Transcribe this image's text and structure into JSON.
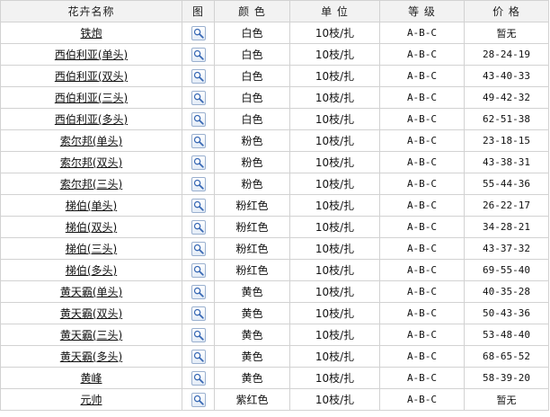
{
  "headers": [
    "花卉名称",
    "图",
    "颜 色",
    "单 位",
    "等 级",
    "价 格"
  ],
  "icon": "magnifier-icon",
  "rows": [
    {
      "name": "铁炮",
      "color": "白色",
      "unit": "10枝/扎",
      "grade": "A-B-C",
      "price": "暂无"
    },
    {
      "name": "西伯利亚(单头)",
      "color": "白色",
      "unit": "10枝/扎",
      "grade": "A-B-C",
      "price": "28-24-19"
    },
    {
      "name": "西伯利亚(双头)",
      "color": "白色",
      "unit": "10枝/扎",
      "grade": "A-B-C",
      "price": "43-40-33"
    },
    {
      "name": "西伯利亚(三头)",
      "color": "白色",
      "unit": "10枝/扎",
      "grade": "A-B-C",
      "price": "49-42-32"
    },
    {
      "name": "西伯利亚(多头)",
      "color": "白色",
      "unit": "10枝/扎",
      "grade": "A-B-C",
      "price": "62-51-38"
    },
    {
      "name": "索尔邦(单头)",
      "color": "粉色",
      "unit": "10枝/扎",
      "grade": "A-B-C",
      "price": "23-18-15"
    },
    {
      "name": "索尔邦(双头)",
      "color": "粉色",
      "unit": "10枝/扎",
      "grade": "A-B-C",
      "price": "43-38-31"
    },
    {
      "name": "索尔邦(三头)",
      "color": "粉色",
      "unit": "10枝/扎",
      "grade": "A-B-C",
      "price": "55-44-36"
    },
    {
      "name": "梯伯(单头)",
      "color": "粉红色",
      "unit": "10枝/扎",
      "grade": "A-B-C",
      "price": "26-22-17"
    },
    {
      "name": "梯伯(双头)",
      "color": "粉红色",
      "unit": "10枝/扎",
      "grade": "A-B-C",
      "price": "34-28-21"
    },
    {
      "name": "梯伯(三头)",
      "color": "粉红色",
      "unit": "10枝/扎",
      "grade": "A-B-C",
      "price": "43-37-32"
    },
    {
      "name": "梯伯(多头)",
      "color": "粉红色",
      "unit": "10枝/扎",
      "grade": "A-B-C",
      "price": "69-55-40"
    },
    {
      "name": "黄天霸(单头)",
      "color": "黄色",
      "unit": "10枝/扎",
      "grade": "A-B-C",
      "price": "40-35-28"
    },
    {
      "name": "黄天霸(双头)",
      "color": "黄色",
      "unit": "10枝/扎",
      "grade": "A-B-C",
      "price": "50-43-36"
    },
    {
      "name": "黄天霸(三头)",
      "color": "黄色",
      "unit": "10枝/扎",
      "grade": "A-B-C",
      "price": "53-48-40"
    },
    {
      "name": "黄天霸(多头)",
      "color": "黄色",
      "unit": "10枝/扎",
      "grade": "A-B-C",
      "price": "68-65-52"
    },
    {
      "name": "黄峰",
      "color": "黄色",
      "unit": "10枝/扎",
      "grade": "A-B-C",
      "price": "58-39-20"
    },
    {
      "name": "元帅",
      "color": "紫红色",
      "unit": "10枝/扎",
      "grade": "A-B-C",
      "price": "暂无"
    }
  ]
}
